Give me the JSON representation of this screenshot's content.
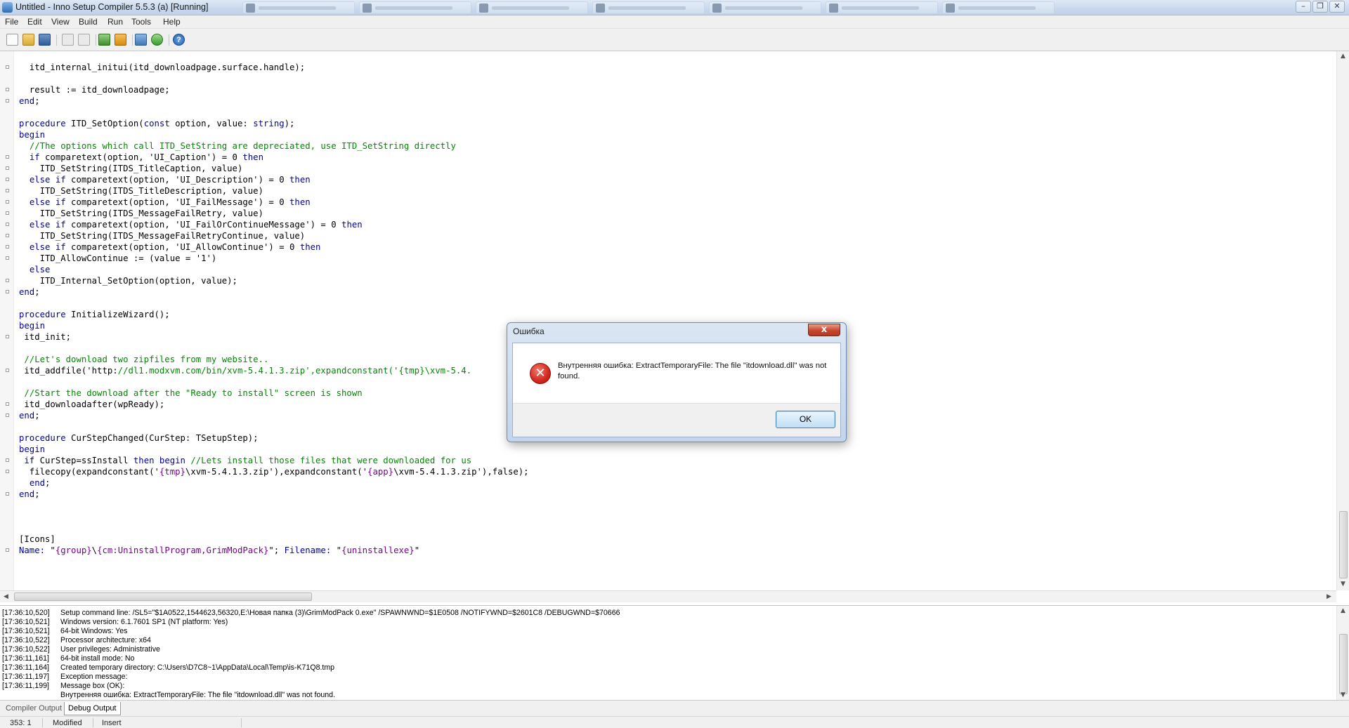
{
  "window": {
    "title": "Untitled - Inno Setup Compiler 5.5.3 (a)  [Running]"
  },
  "menu": [
    "File",
    "Edit",
    "View",
    "Build",
    "Run",
    "Tools",
    "Help"
  ],
  "toolbar": [
    "new-file-icon",
    "open-folder-icon",
    "save-icon",
    "compile-icon",
    "stop-compile-icon",
    "run-icon",
    "pause-icon",
    "target-icon",
    "refresh-icon",
    "help-icon"
  ],
  "editor": {
    "lines": [
      {
        "t": "  itd_internal_initui(itd_downloadpage.surface.handle);"
      },
      {
        "t": ""
      },
      {
        "t": "  result := itd_downloadpage;"
      },
      {
        "t": "end;"
      },
      {
        "t": ""
      },
      {
        "t": "procedure ITD_SetOption(const option, value: string);"
      },
      {
        "t": "begin"
      },
      {
        "t": "  //The options which call ITD_SetString are depreciated, use ITD_SetString directly"
      },
      {
        "t": "  if comparetext(option, 'UI_Caption') = 0 then"
      },
      {
        "t": "    ITD_SetString(ITDS_TitleCaption, value)"
      },
      {
        "t": "  else if comparetext(option, 'UI_Description') = 0 then"
      },
      {
        "t": "    ITD_SetString(ITDS_TitleDescription, value)"
      },
      {
        "t": "  else if comparetext(option, 'UI_FailMessage') = 0 then"
      },
      {
        "t": "    ITD_SetString(ITDS_MessageFailRetry, value)"
      },
      {
        "t": "  else if comparetext(option, 'UI_FailOrContinueMessage') = 0 then"
      },
      {
        "t": "    ITD_SetString(ITDS_MessageFailRetryContinue, value)"
      },
      {
        "t": "  else if comparetext(option, 'UI_AllowContinue') = 0 then"
      },
      {
        "t": "    ITD_AllowContinue := (value = '1')"
      },
      {
        "t": "  else"
      },
      {
        "t": "    ITD_Internal_SetOption(option, value);"
      },
      {
        "t": "end;"
      },
      {
        "t": ""
      },
      {
        "t": "procedure InitializeWizard();"
      },
      {
        "t": "begin"
      },
      {
        "t": " itd_init;"
      },
      {
        "t": ""
      },
      {
        "t": " //Let's download two zipfiles from my website.."
      },
      {
        "t": " itd_addfile('http://dl1.modxvm.com/bin/xvm-5.4.1.3.zip',expandconstant('{tmp}\\xvm-5.4."
      },
      {
        "t": ""
      },
      {
        "t": " //Start the download after the \"Ready to install\" screen is shown"
      },
      {
        "t": " itd_downloadafter(wpReady);"
      },
      {
        "t": "end;"
      },
      {
        "t": ""
      },
      {
        "t": "procedure CurStepChanged(CurStep: TSetupStep);"
      },
      {
        "t": "begin"
      },
      {
        "t": " if CurStep=ssInstall then begin //Lets install those files that were downloaded for us"
      },
      {
        "t": "  filecopy(expandconstant('{tmp}\\xvm-5.4.1.3.zip'),expandconstant('{app}\\xvm-5.4.1.3.zip'),false);"
      },
      {
        "t": "  end;"
      },
      {
        "t": "end;"
      },
      {
        "t": ""
      },
      {
        "t": ""
      },
      {
        "t": ""
      },
      {
        "t": "[Icons]"
      },
      {
        "t": "Name: \"{group}\\{cm:UninstallProgram,GrimModPack}\"; Filename: \"{uninstallexe}\""
      }
    ]
  },
  "debug_output": [
    {
      "ts": "[17:36:10,520]",
      "msg": "Setup command line: /SL5=\"$1A0522,1544623,56320,E:\\Новая папка (3)\\GrimModPack 0.exe\" /SPAWNWND=$1E0508 /NOTIFYWND=$2601C8 /DEBUGWND=$70666"
    },
    {
      "ts": "[17:36:10,521]",
      "msg": "Windows version: 6.1.7601 SP1  (NT platform: Yes)"
    },
    {
      "ts": "[17:36:10,521]",
      "msg": "64-bit Windows: Yes"
    },
    {
      "ts": "[17:36:10,522]",
      "msg": "Processor architecture: x64"
    },
    {
      "ts": "[17:36:10,522]",
      "msg": "User privileges: Administrative"
    },
    {
      "ts": "[17:36:11,161]",
      "msg": "64-bit install mode: No"
    },
    {
      "ts": "[17:36:11,164]",
      "msg": "Created temporary directory: C:\\Users\\D7C8~1\\AppData\\Local\\Temp\\is-K71Q8.tmp"
    },
    {
      "ts": "[17:36:11,197]",
      "msg": "Exception message:"
    },
    {
      "ts": "[17:36:11,199]",
      "msg": "Message box (OK):"
    },
    {
      "ts": "",
      "msg": "Внутренняя ошибка: ExtractTemporaryFile: The file \"itdownload.dll\" was not found."
    }
  ],
  "tabs": {
    "compiler_output": "Compiler Output",
    "debug_output": "Debug Output"
  },
  "status": {
    "position": "353:   1",
    "modified": "Modified",
    "mode": "Insert"
  },
  "dialog": {
    "title": "Ошибка",
    "close_label": "x",
    "icon": "error-icon",
    "message": "Внутренняя ошибка: ExtractTemporaryFile: The file \"itdownload.dll\" was not found.",
    "ok_label": "OK"
  }
}
